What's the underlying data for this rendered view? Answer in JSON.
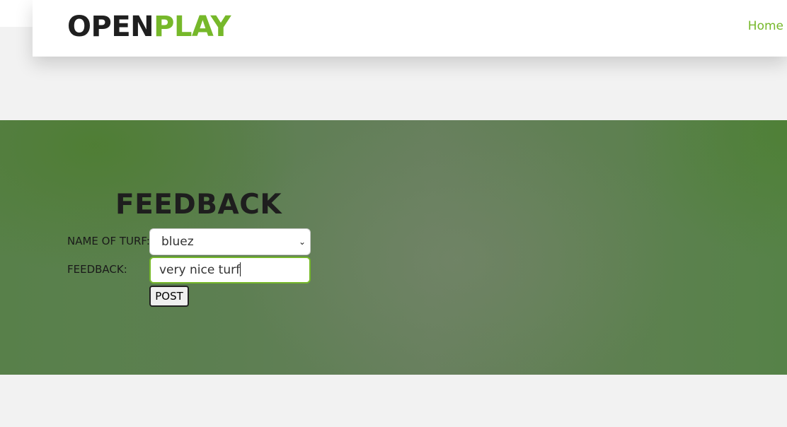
{
  "header": {
    "logo_part1": "OPEN",
    "logo_part2": "PLAY",
    "nav": {
      "home_label": "Home"
    }
  },
  "feedback_form": {
    "title": "FEEDBACK",
    "turf_label": "NAME OF TURF:",
    "turf_selected": "bluez",
    "feedback_label": "FEEDBACK:",
    "feedback_value": "very nice turf",
    "post_label": "POST"
  },
  "colors": {
    "accent": "#76b82a",
    "dark_text": "#1e1e1e",
    "hero_green": "#5d7f52",
    "page_bg": "#f2f2f2"
  }
}
